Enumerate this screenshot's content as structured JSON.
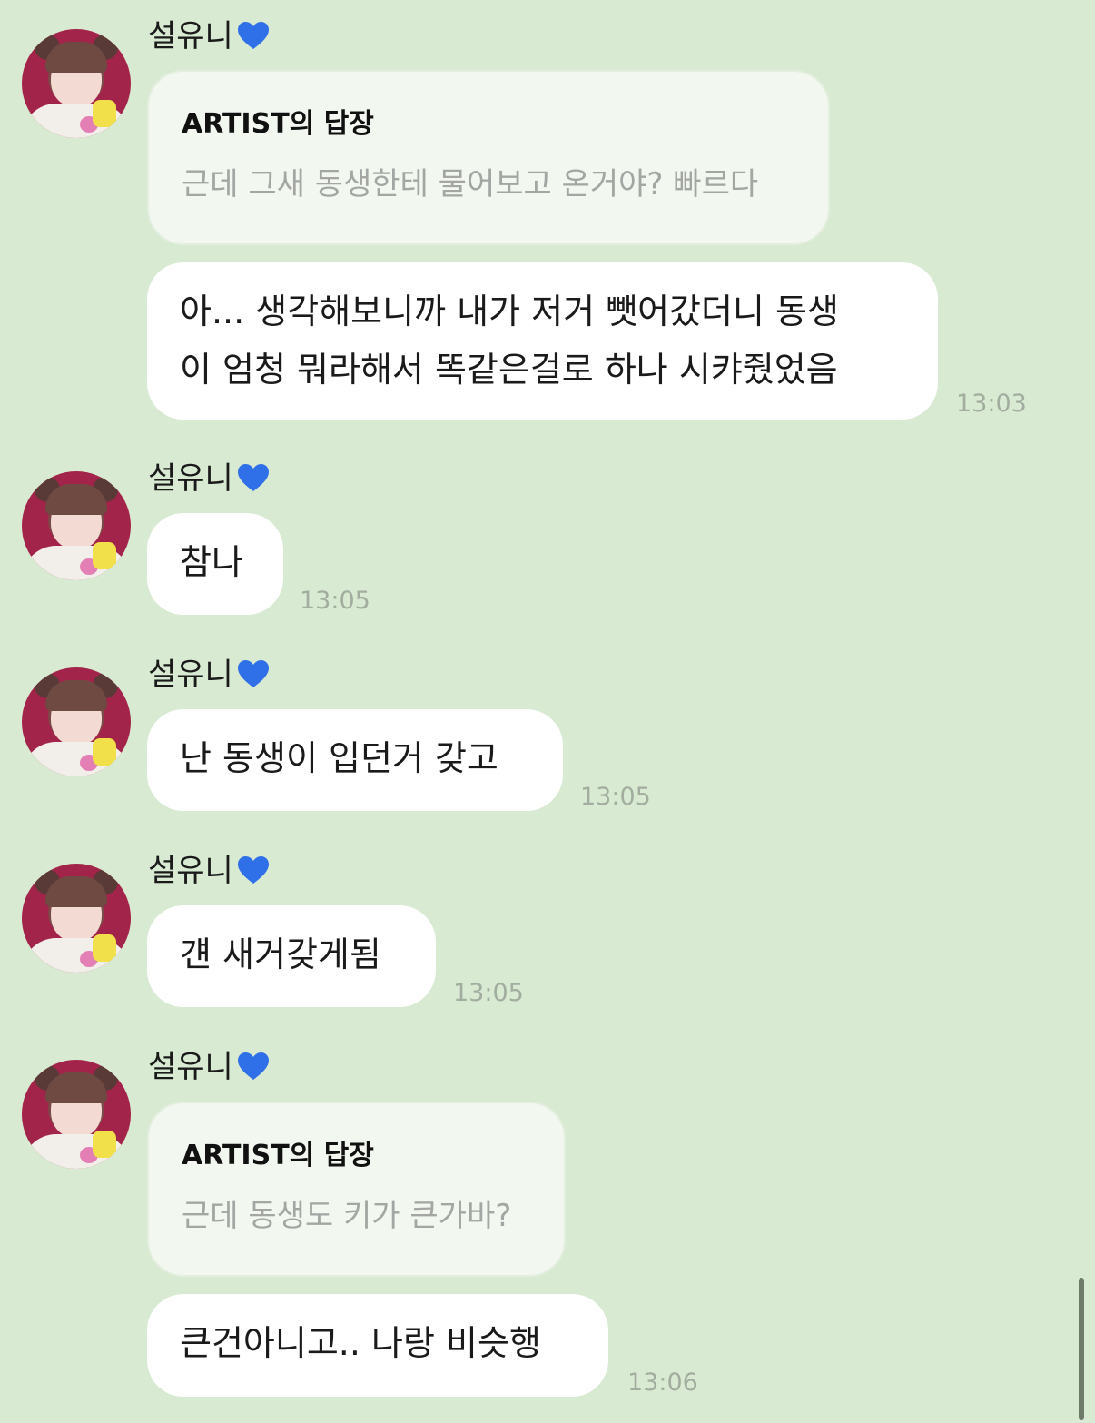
{
  "chat": {
    "sender_name": "설유니",
    "sender_emoji": "blue-heart",
    "reply_header": "ARTIST의 답장",
    "colors": {
      "background": "#d8ead2",
      "bubble": "#ffffff",
      "reply_bubble": "#f2f7ef",
      "reply_text": "#a3a6a2",
      "timestamp": "#a3ad9f",
      "heart": "#2f6fe8"
    },
    "groups": [
      {
        "sender": "설유니",
        "reply": {
          "title": "ARTIST의 답장",
          "text": "근데 그새 동생한테 물어보고 온거야? 빠르다"
        },
        "message_lines": [
          "아... 생각해보니까 내가 저거 뺏어갔더니 동생",
          "이 엄청 뭐라해서 똑같은걸로 하나 시캬줬었음"
        ],
        "time": "13:03"
      },
      {
        "sender": "설유니",
        "message": "참나",
        "time": "13:05"
      },
      {
        "sender": "설유니",
        "message": "난 동생이 입던거 갖고",
        "time": "13:05"
      },
      {
        "sender": "설유니",
        "message": "걘 새거갖게됨",
        "time": "13:05"
      },
      {
        "sender": "설유니",
        "reply": {
          "title": "ARTIST의 답장",
          "text": "근데 동생도 키가 큰가바?"
        },
        "message": "큰건아니고.. 나랑 비슷행",
        "time": "13:06"
      }
    ]
  }
}
